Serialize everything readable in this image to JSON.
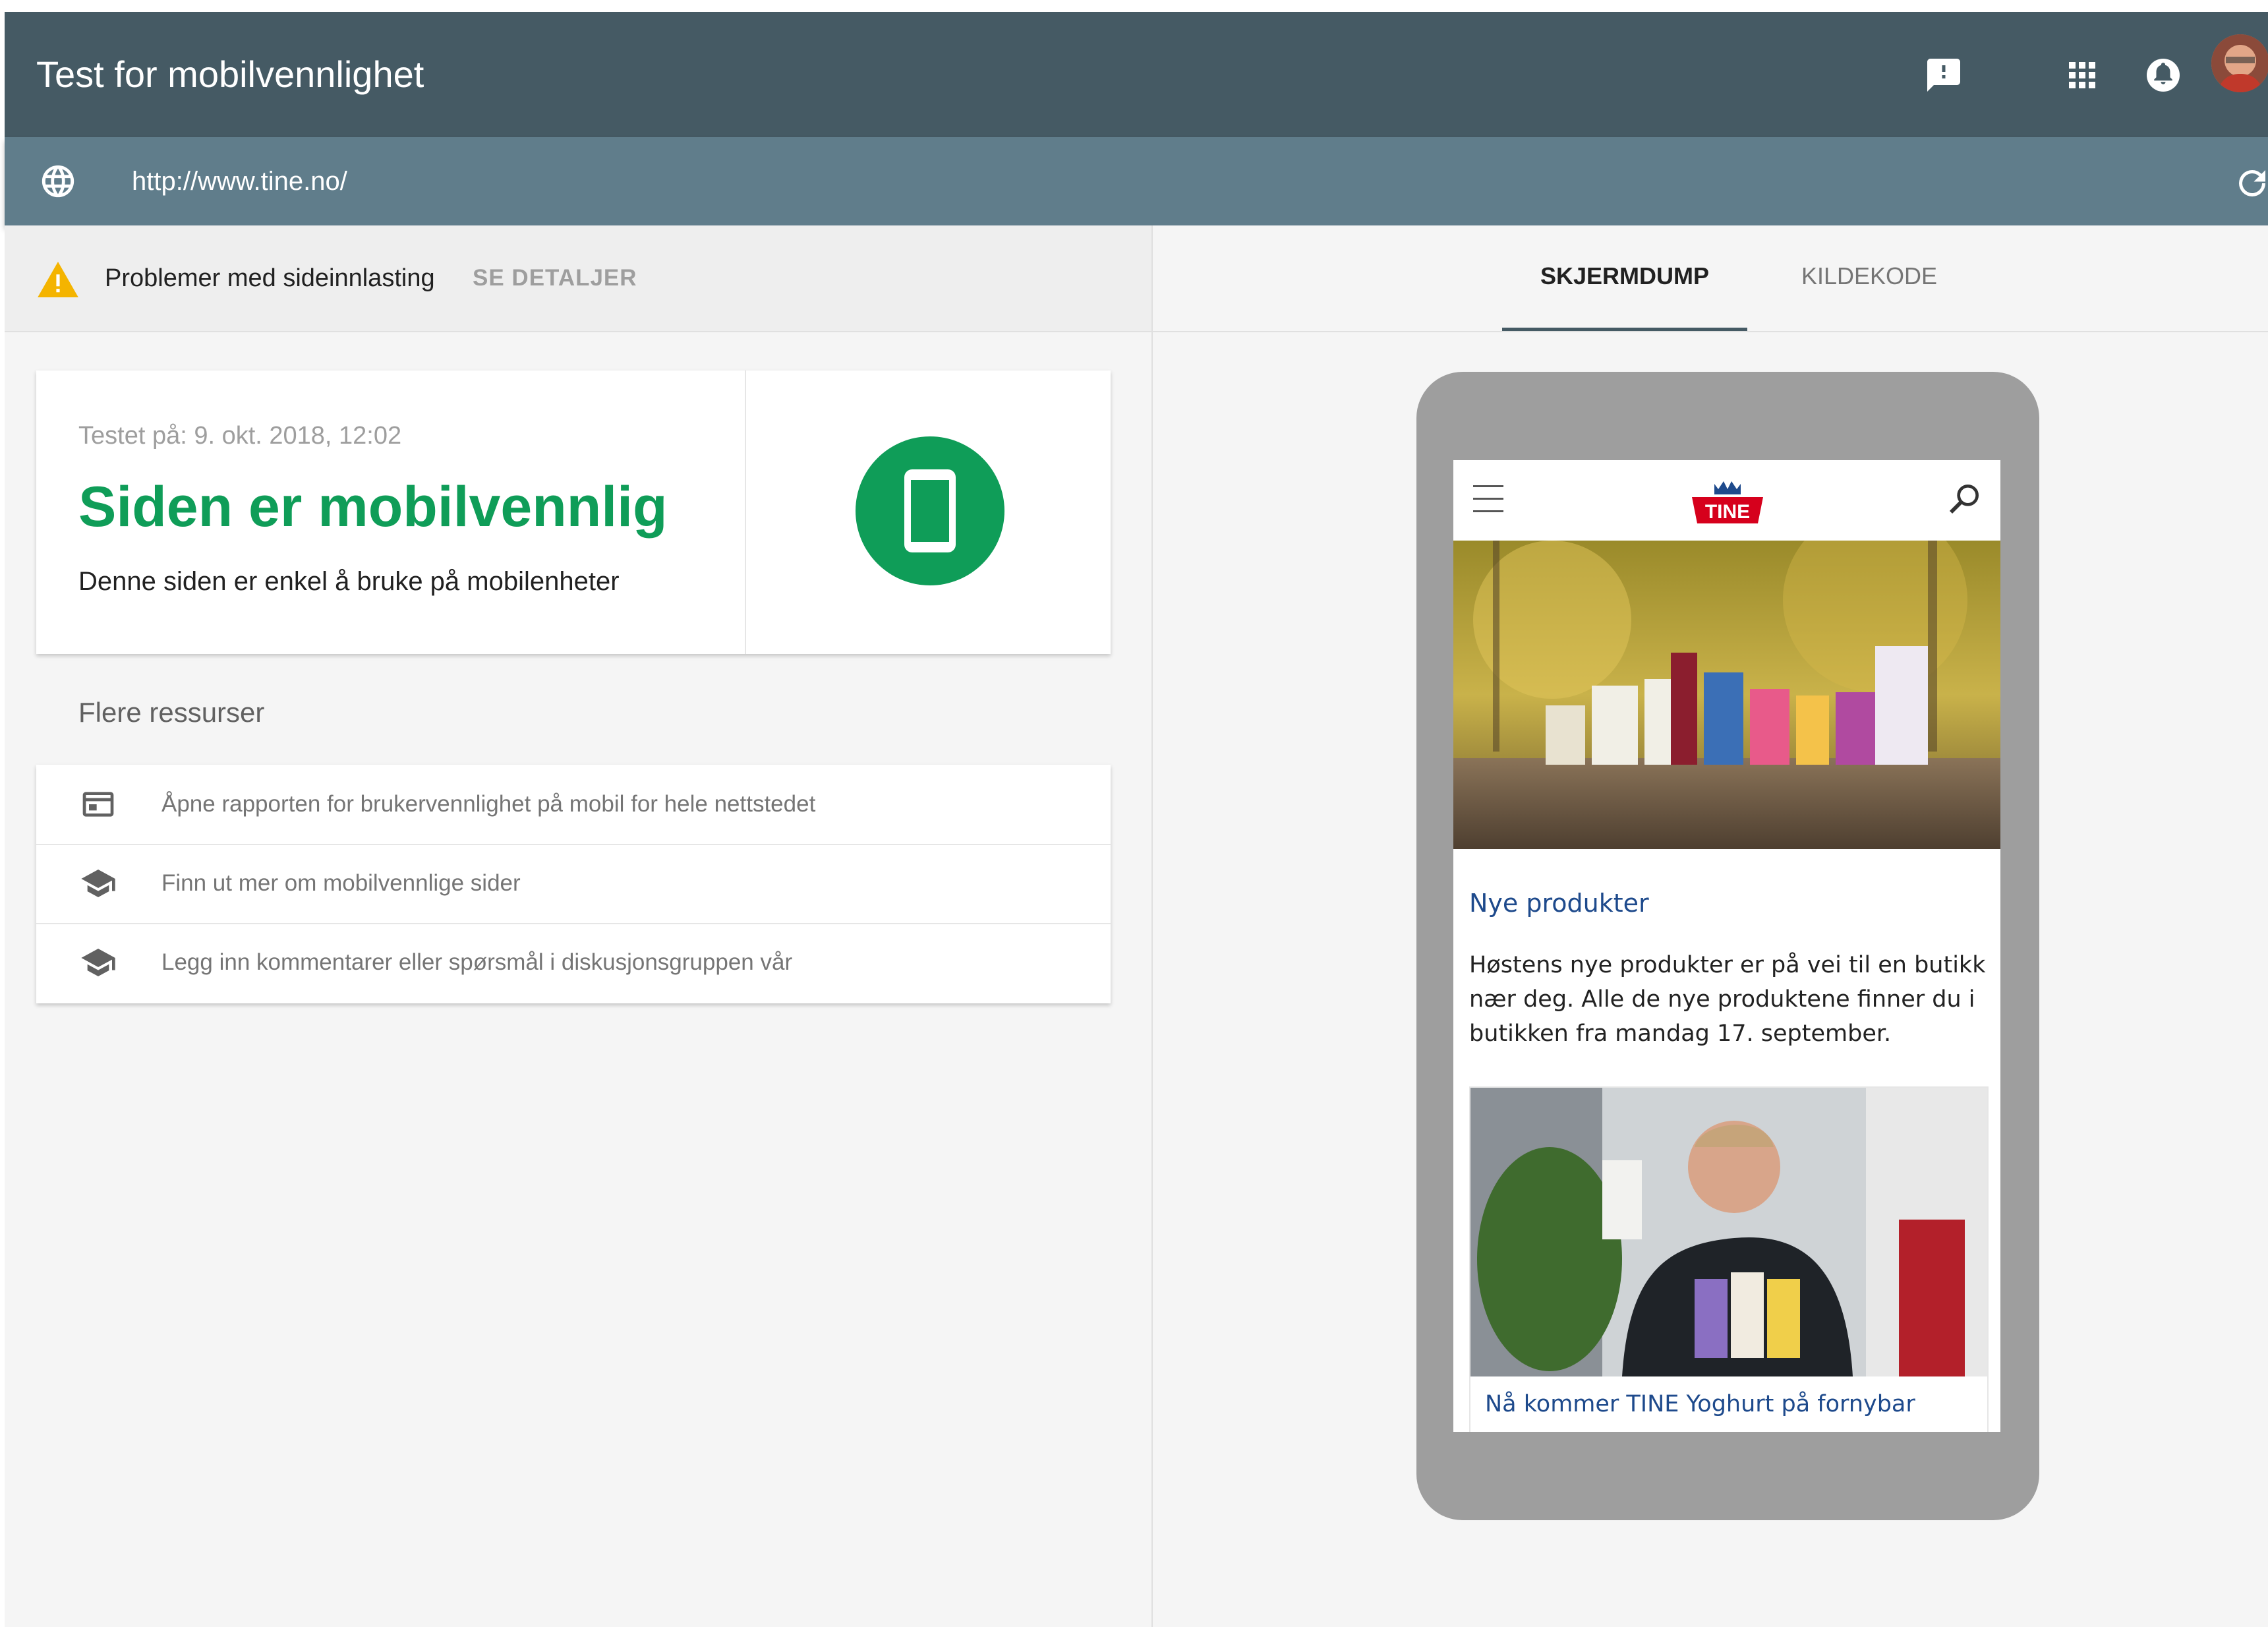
{
  "app": {
    "title": "Test for mobilvennlighet",
    "header_icons": [
      "feedback-icon",
      "apps-grid-icon",
      "notifications-icon",
      "avatar"
    ]
  },
  "urlbar": {
    "url": "http://www.tine.no/",
    "icons": [
      "globe-icon",
      "reload-icon"
    ]
  },
  "issue": {
    "message": "Problemer med sideinnlasting",
    "details_label": "SE DETALJER",
    "icon": "warning-icon"
  },
  "result": {
    "tested_at": "Testet på: 9. okt. 2018, 12:02",
    "headline": "Siden er mobilvennlig",
    "subtitle": "Denne siden er enkel å bruke på mobilenheter",
    "icon": "smartphone-icon"
  },
  "resources": {
    "title": "Flere ressurser",
    "items": [
      {
        "label": "Åpne rapporten for brukervennlighet på mobil for hele nettstedet",
        "icon": "report-icon"
      },
      {
        "label": "Finn ut mer om mobilvennlige sider",
        "icon": "school-icon"
      },
      {
        "label": "Legg inn kommentarer eller spørsmål i diskusjonsgruppen vår",
        "icon": "school-icon"
      }
    ]
  },
  "tabs": [
    {
      "label": "SKJERMDUMP",
      "active": true
    },
    {
      "label": "KILDEKODE",
      "active": false
    }
  ],
  "mobile_preview": {
    "logo_text": "TINE",
    "section_title": "Nye produkter",
    "body": "Høstens nye produkter er på vei til en butikk nær deg. Alle de nye produktene finner du i butikken fra mandag 17. september.",
    "card_title": "Nå kommer TINE Yoghurt på fornybar"
  },
  "colors": {
    "appbar": "#455a64",
    "urlbar": "#607d8b",
    "success_green": "#0f9d58",
    "link_blue": "#1e4a8c",
    "warning": "#f4b400"
  }
}
